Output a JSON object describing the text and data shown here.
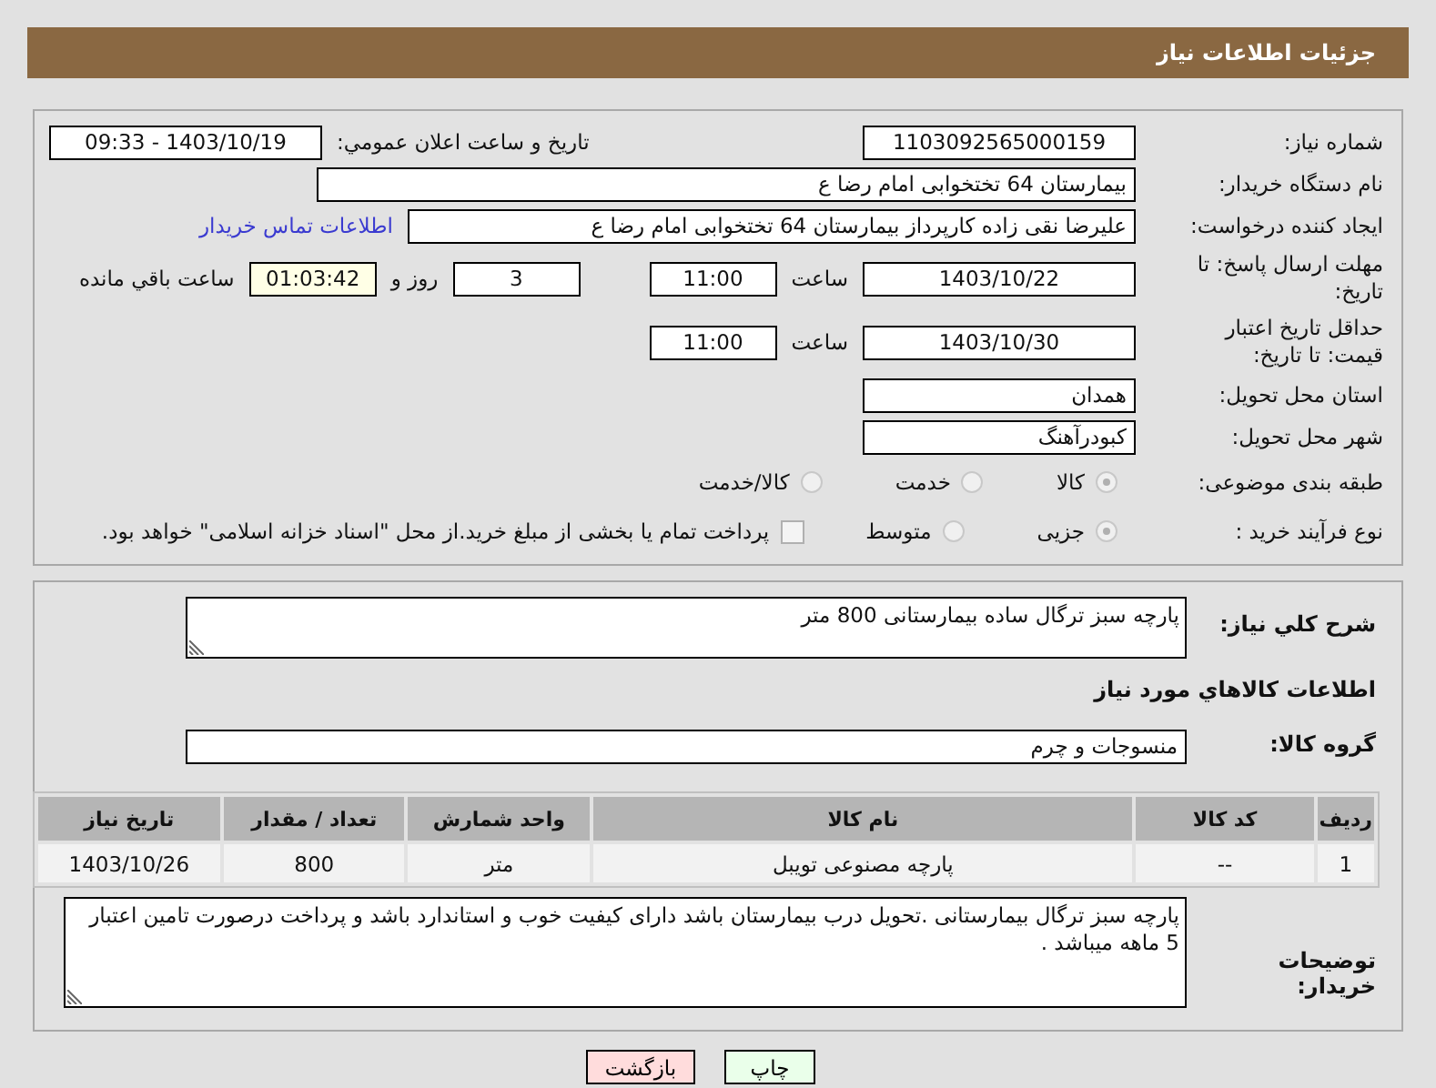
{
  "header": {
    "title": "جزئیات اطلاعات نیاز"
  },
  "details": {
    "need_number": {
      "label": "شماره نیاز:",
      "value": "1103092565000159"
    },
    "announce": {
      "label": "تاریخ و ساعت اعلان عمومي:",
      "value": "1403/10/19 - 09:33"
    },
    "buyer": {
      "label": "نام دستگاه خریدار:",
      "value": "بیمارستان  64 تختخوابی امام رضا   ع"
    },
    "creator": {
      "label": "ایجاد کننده درخواست:",
      "value": "علیرضا نقی زاده کارپرداز بیمارستان  64 تختخوابی امام رضا   ع",
      "link": "اطلاعات تماس خریدار"
    },
    "deadline": {
      "label": "مهلت ارسال پاسخ: تا تاریخ:",
      "date": "1403/10/22",
      "time_label": "ساعت",
      "time": "11:00",
      "days": "3",
      "days_label": "روز و",
      "remaining": "01:03:42",
      "remaining_label": "ساعت باقي مانده"
    },
    "validity": {
      "label": "حداقل تاریخ اعتبار قیمت: تا تاریخ:",
      "date": "1403/10/30",
      "time_label": "ساعت",
      "time": "11:00"
    },
    "province": {
      "label": "استان محل تحویل:",
      "value": "همدان"
    },
    "city": {
      "label": "شهر محل تحویل:",
      "value": "کبودرآهنگ"
    },
    "classification": {
      "label": "طبقه بندی موضوعی:",
      "options": [
        {
          "label": "کالا",
          "selected": true
        },
        {
          "label": "خدمت",
          "selected": false
        },
        {
          "label": "کالا/خدمت",
          "selected": false
        }
      ]
    },
    "purchase_type": {
      "label": "نوع فرآیند خرید :",
      "options": [
        {
          "label": "جزیی",
          "selected": true
        },
        {
          "label": "متوسط",
          "selected": false
        }
      ],
      "treasury": {
        "checked": false,
        "label": "پرداخت تمام یا بخشی از مبلغ خرید.از محل \"اسناد خزانه اسلامی\" خواهد بود."
      }
    }
  },
  "summary": {
    "label": "شرح کلي نیاز:",
    "value": "پارچه سبز ترگال ساده بیمارستانی 800 متر"
  },
  "goods_title": "اطلاعات کالاهاي مورد نیاز",
  "goods_group": {
    "label": "گروه کالا:",
    "value": "منسوجات و چرم"
  },
  "table": {
    "columns": [
      "ردیف",
      "کد کالا",
      "نام کالا",
      "واحد شمارش",
      "تعداد / مقدار",
      "تاریخ نیاز"
    ],
    "rows": [
      [
        "1",
        "--",
        "پارچه مصنوعی تویبل",
        "متر",
        "800",
        "1403/10/26"
      ]
    ]
  },
  "buyer_notes": {
    "label": "توضیحات خریدار:",
    "value": "پارچه سبز ترگال بیمارستانی .تحویل درب بیمارستان باشد دارای کیفیت خوب و استاندارد باشد و پرداخت درصورت تامین اعتبار 5 ماهه میباشد ."
  },
  "buttons": [
    {
      "kind": "print",
      "label": "چاپ"
    },
    {
      "kind": "back",
      "label": "بازگشت"
    }
  ]
}
